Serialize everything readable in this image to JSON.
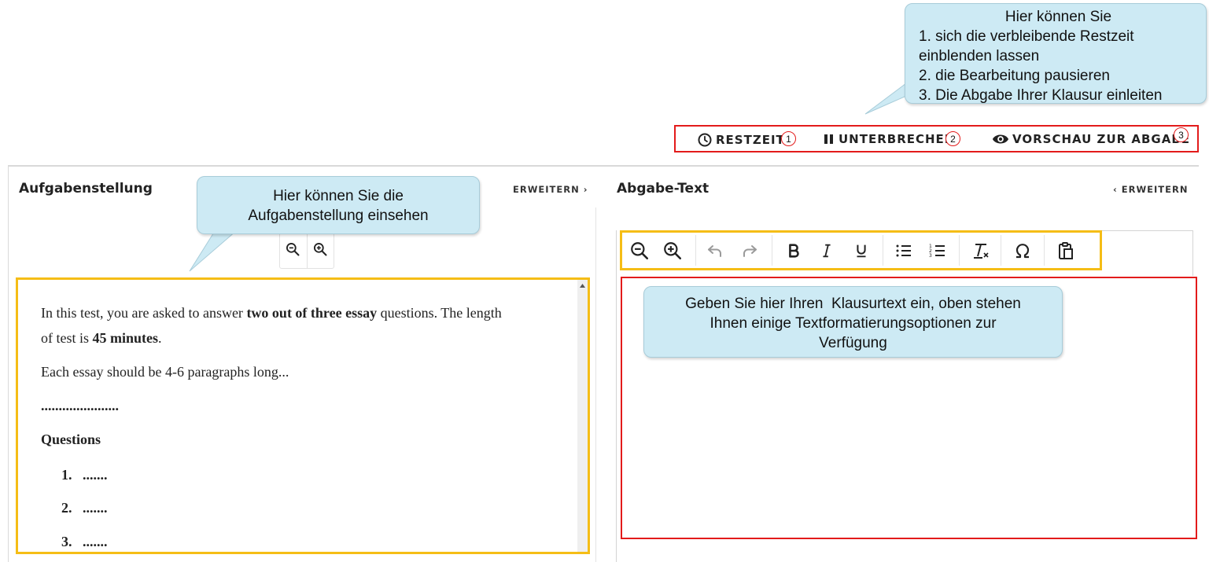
{
  "top_callout": {
    "title": "Hier können Sie",
    "line1": "1. sich die verbleibende Restzeit",
    "line2": "einblenden lassen",
    "line3": "2. die Bearbeitung pausieren",
    "line4": "3. Die Abgabe Ihrer Klausur einleiten"
  },
  "top_toolbar": {
    "restzeit_label": "RESTZEIT",
    "unterbrechen_label": "UNTERBRECHEN",
    "vorschau_label": "VORSCHAU ZUR ABGABE",
    "badge1": "1",
    "badge2": "2",
    "badge3": "3"
  },
  "left_panel": {
    "title": "Aufgabenstellung",
    "expand_label": "ERWEITERN ›"
  },
  "left_callout": {
    "line1": "Hier können Sie die",
    "line2": "Aufgabenstellung einsehen"
  },
  "task": {
    "p1_part1": "In this test, you are asked to answer ",
    "p1_bold": "two out of three essay",
    "p1_part2": " questions. The length",
    "p1_line2_part1": "of test is ",
    "p1_line2_bold": "45 minutes",
    "p1_line2_part2": ".",
    "p2": "Each essay should be 4-6 paragraphs long...",
    "dots": "......................",
    "questions_heading": "Questions",
    "items": [
      "1.   .......",
      "2.   .......",
      "3.   ......."
    ]
  },
  "right_panel": {
    "title": "Abgabe-Text",
    "expand_label": "‹ ERWEITERN"
  },
  "editor_callout": {
    "line1": "Geben Sie hier Ihren  Klausurtext ein, oben stehen",
    "line2": "Ihnen einige Textformatierungsoptionen zur",
    "line3": "Verfügung"
  },
  "colors": {
    "highlight_red": "#e31b1b",
    "highlight_yellow": "#f5bd16",
    "callout_fill": "#cdeaf4"
  },
  "icons": {
    "restzeit": "clock-icon",
    "unterbrechen": "pause-icon",
    "vorschau": "eye-icon",
    "zoom_out": "zoom-out-icon",
    "zoom_in": "zoom-in-icon",
    "undo": "undo-icon",
    "redo": "redo-icon",
    "bold": "bold-icon",
    "italic": "italic-icon",
    "underline": "underline-icon",
    "bullet_list": "bullet-list-icon",
    "numbered_list": "numbered-list-icon",
    "clear_format": "clear-format-icon",
    "special_char": "omega-icon",
    "paste": "paste-icon"
  }
}
